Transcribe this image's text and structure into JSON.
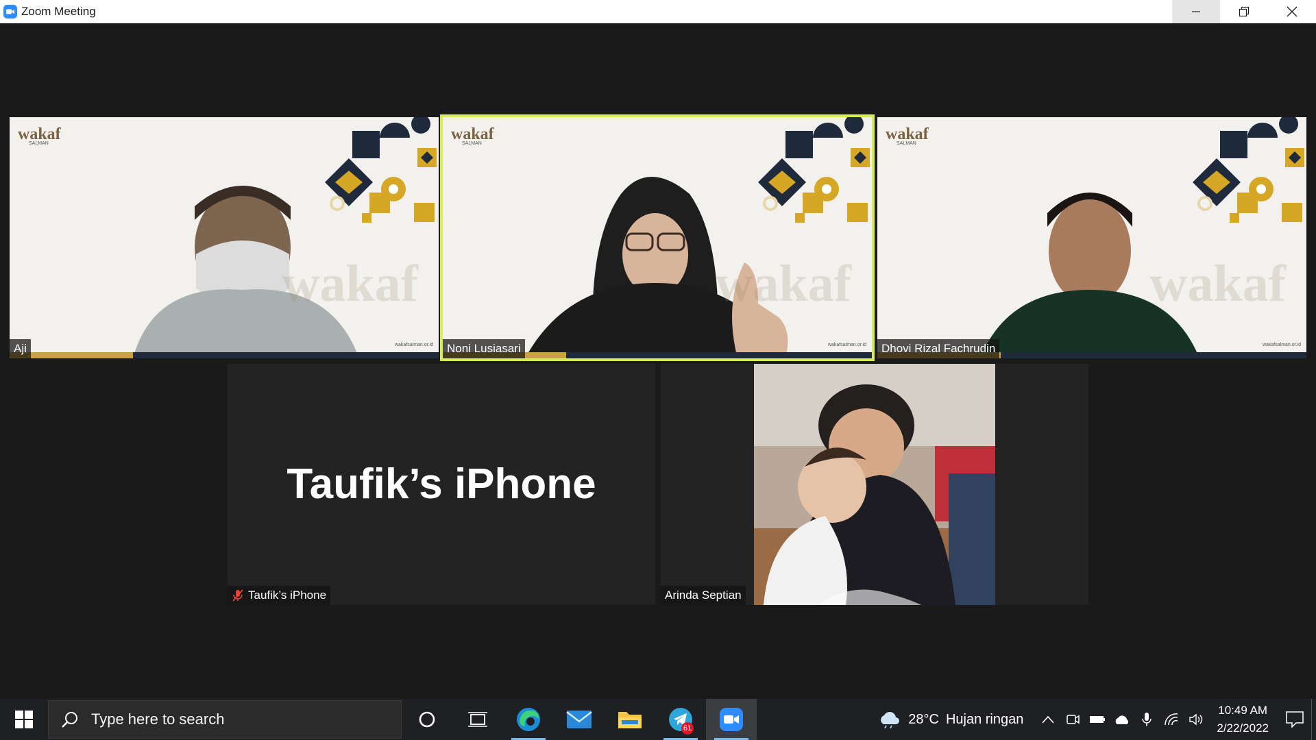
{
  "window": {
    "title": "Zoom Meeting"
  },
  "participants": [
    {
      "name": "Aji",
      "logo": "wakaf",
      "logo_sub": "SALMAN",
      "watermark": "wakaf",
      "website": "wakafsalman.or.id"
    },
    {
      "name": "Noni Lusiasari",
      "logo": "wakaf",
      "logo_sub": "SALMAN",
      "watermark": "wakaf",
      "website": "wakafsalman.or.id",
      "active_speaker": true
    },
    {
      "name": "Dhovi Rizal Fachrudin",
      "logo": "wakaf",
      "logo_sub": "SALMAN",
      "watermark": "wakaf",
      "website": "wakafsalman.or.id"
    },
    {
      "name": "Taufik’s iPhone",
      "display_name": "Taufik’s iPhone",
      "muted": true,
      "video": false
    },
    {
      "name": "Arinda Septian"
    }
  ],
  "colors": {
    "active_border": "#d6ec5a",
    "tile_bg": "#232323",
    "stage_bg": "#1a1a1a",
    "accent_gold": "#d6a725",
    "accent_navy": "#1f2b3d"
  },
  "taskbar": {
    "search_placeholder": "Type here to search",
    "apps": [
      "cortana-icon",
      "task-view-icon",
      "edge-icon",
      "mail-icon",
      "file-explorer-icon",
      "telegram-icon",
      "zoom-icon"
    ],
    "telegram_badge": "61",
    "weather": {
      "temp": "28°C",
      "desc": "Hujan ringan"
    },
    "time": "10:49 AM",
    "date": "2/22/2022"
  }
}
